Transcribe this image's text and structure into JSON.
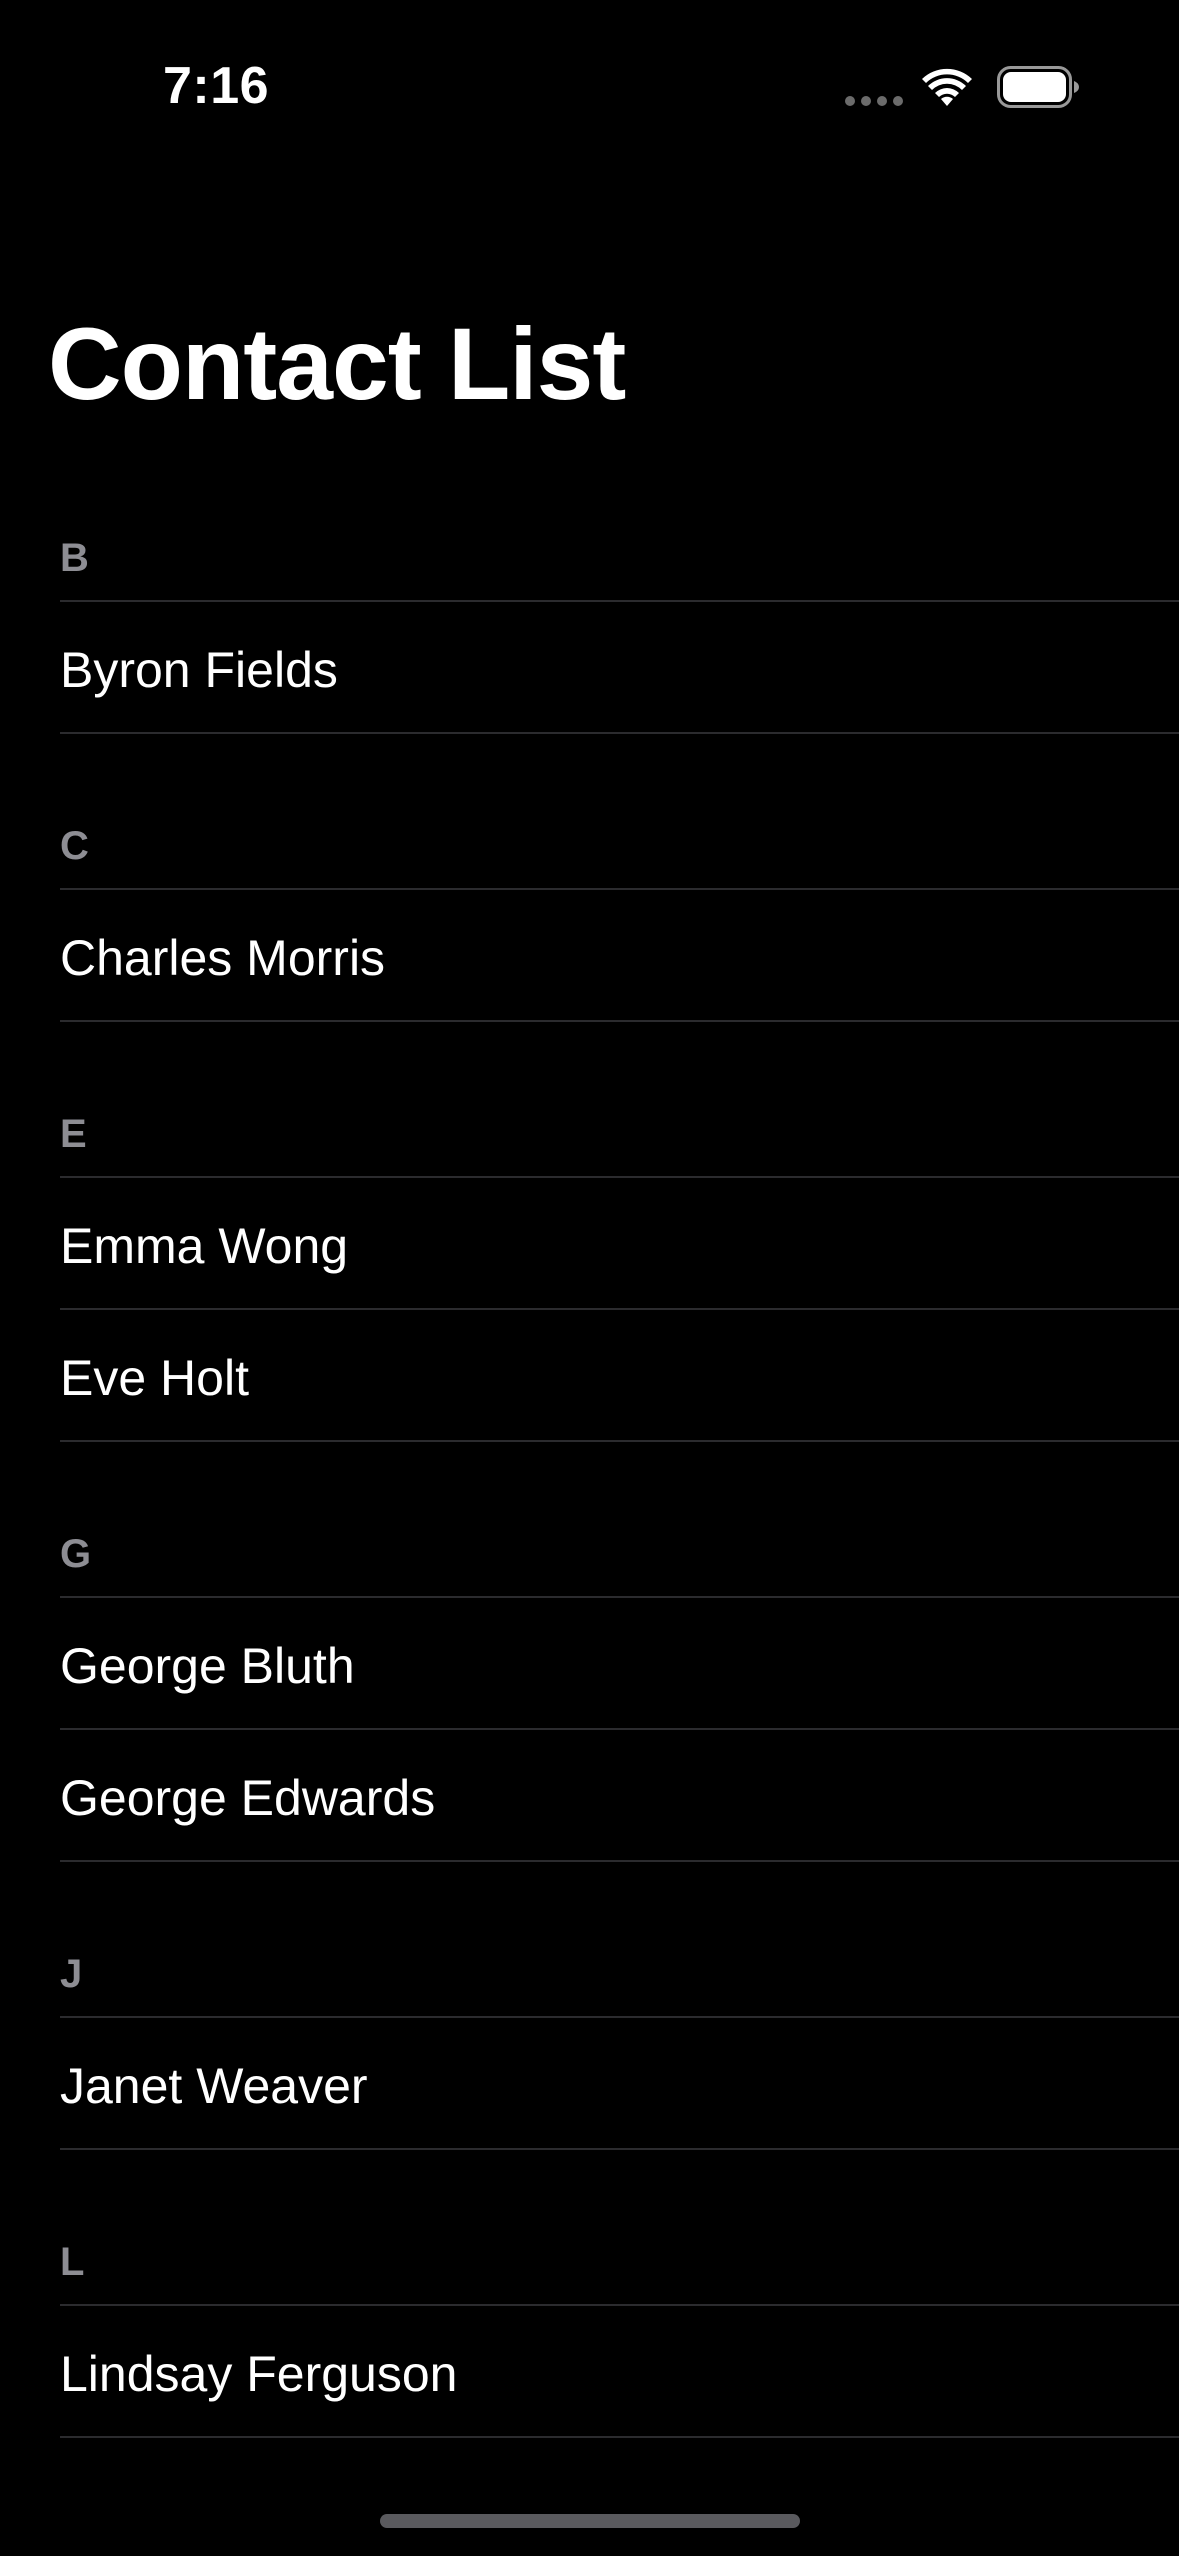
{
  "status_bar": {
    "time": "7:16",
    "icons": [
      "signal-icon",
      "wifi-icon",
      "battery-icon"
    ]
  },
  "page": {
    "title": "Contact List"
  },
  "contacts": {
    "sections": [
      {
        "letter": "B",
        "names": [
          "Byron Fields"
        ]
      },
      {
        "letter": "C",
        "names": [
          "Charles Morris"
        ]
      },
      {
        "letter": "E",
        "names": [
          "Emma Wong",
          "Eve Holt"
        ]
      },
      {
        "letter": "G",
        "names": [
          "George Bluth",
          "George Edwards"
        ]
      },
      {
        "letter": "J",
        "names": [
          "Janet Weaver"
        ]
      },
      {
        "letter": "L",
        "names": [
          "Lindsay Ferguson"
        ]
      }
    ]
  },
  "colors": {
    "background": "#000000",
    "text": "#ffffff",
    "section_header": "#8d8d93",
    "separator": "#2b2b2e"
  }
}
